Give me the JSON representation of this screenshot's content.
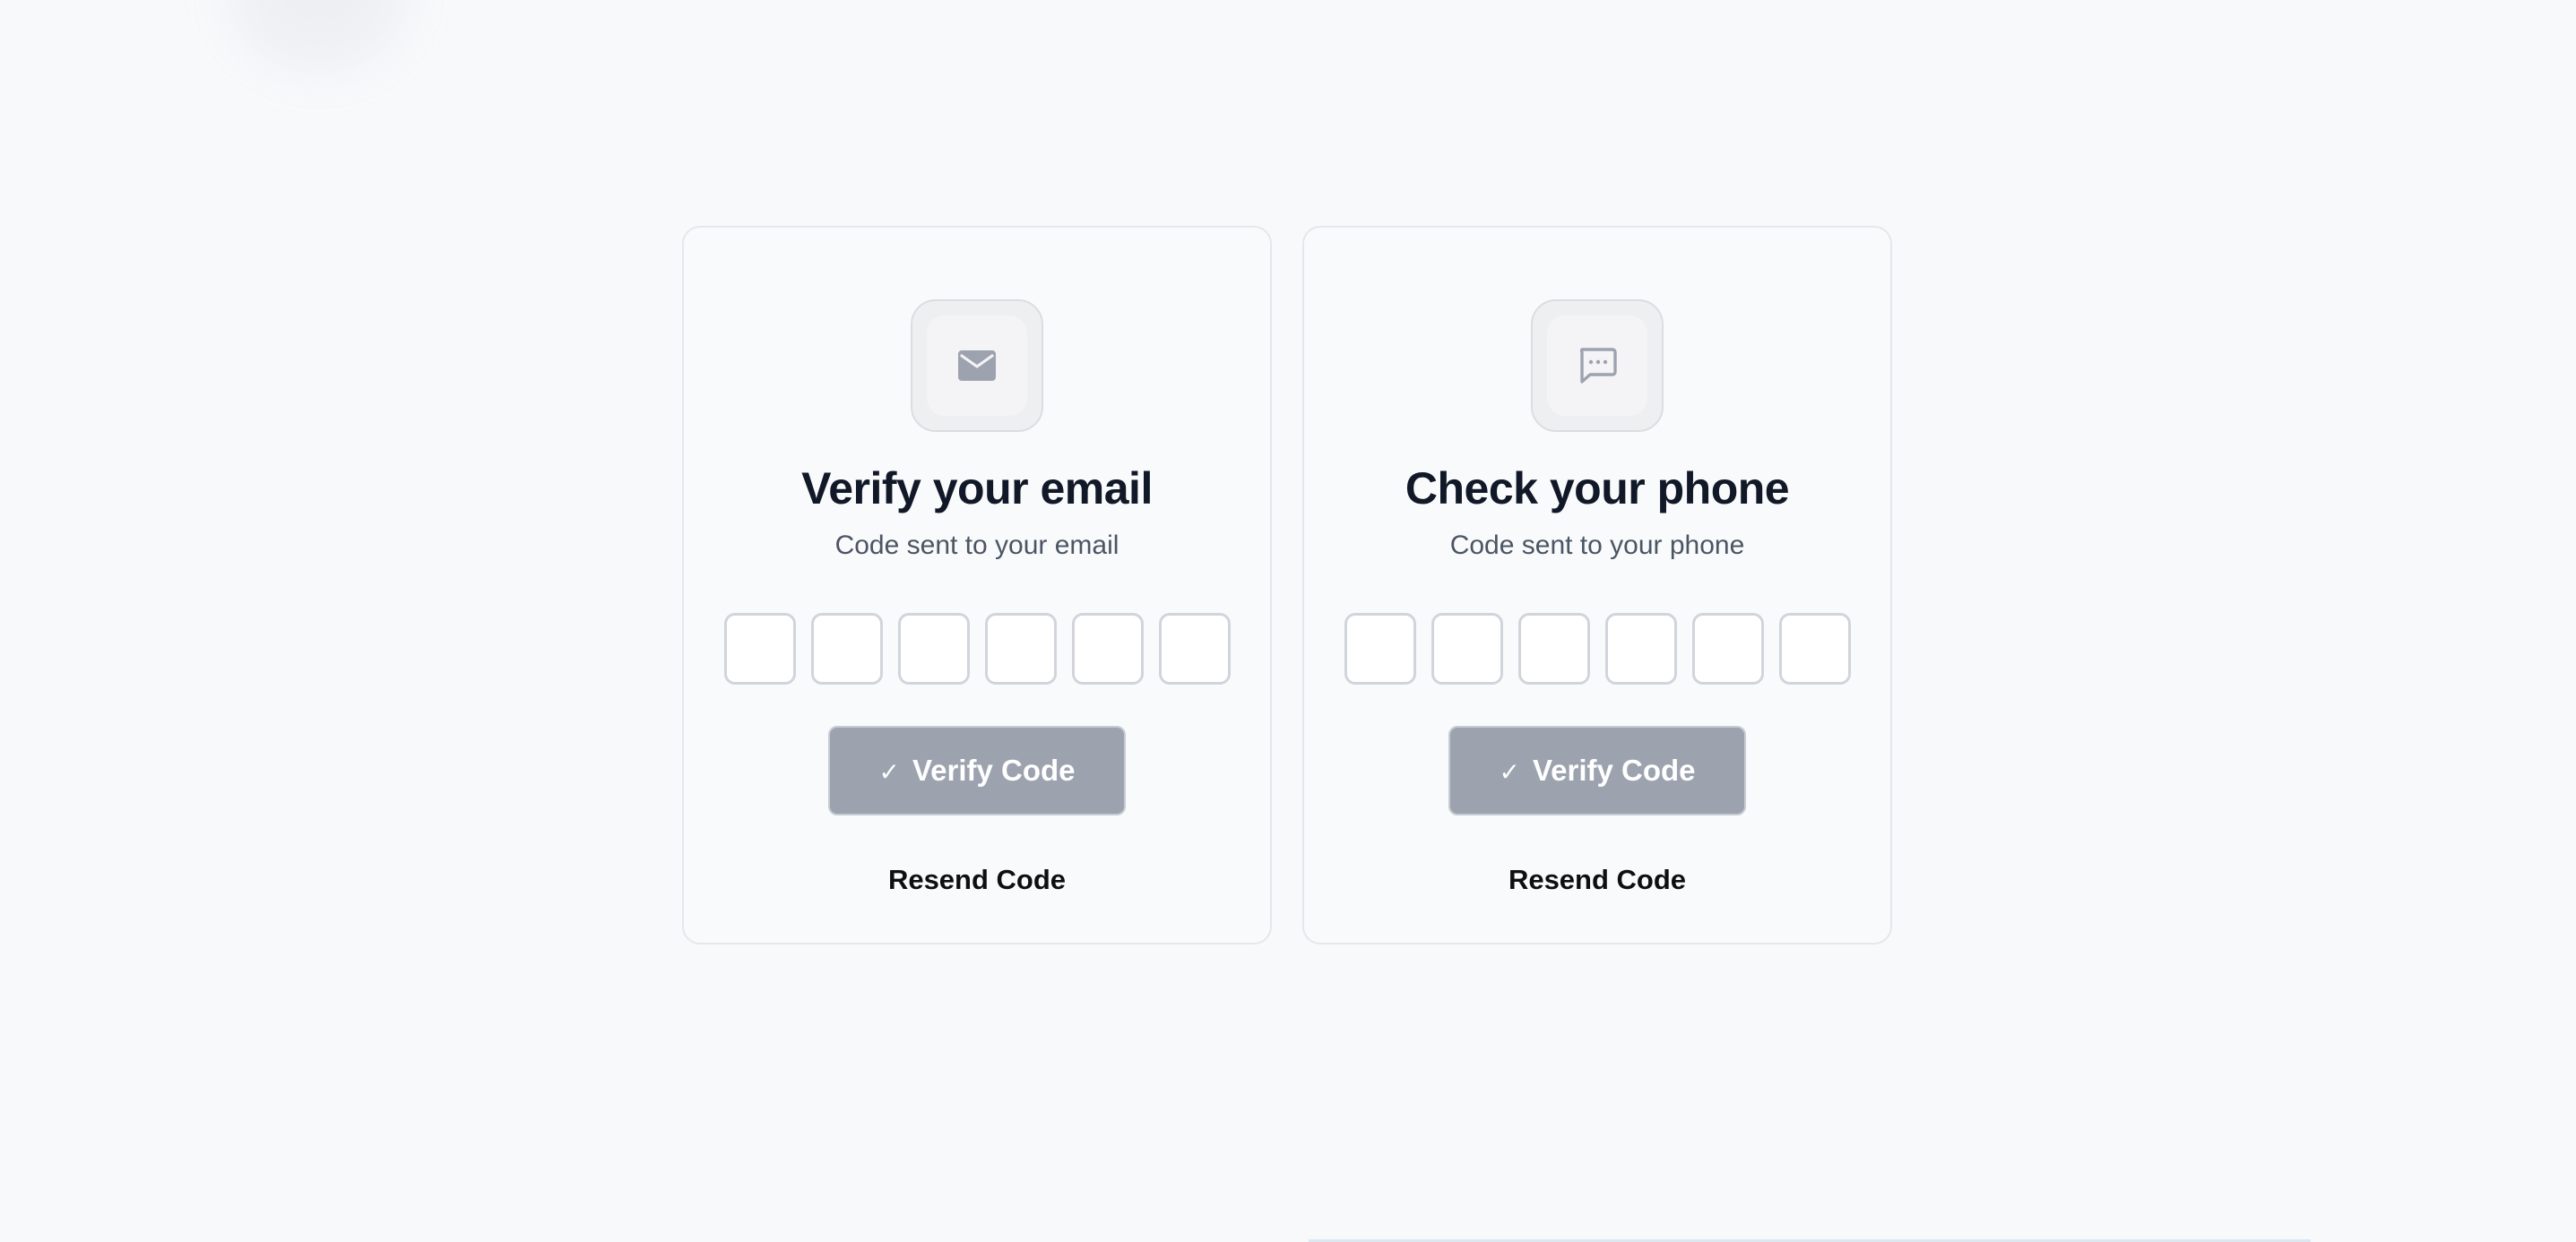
{
  "cards": {
    "email": {
      "icon": "mail-icon",
      "title": "Verify your email",
      "subtitle": "Code sent to your email",
      "code_digits": [
        "",
        "",
        "",
        "",
        "",
        ""
      ],
      "verify_label": "Verify Code",
      "resend_label": "Resend Code"
    },
    "phone": {
      "icon": "message-icon",
      "title": "Check your phone",
      "subtitle": "Code sent to your phone",
      "code_digits": [
        "",
        "",
        "",
        "",
        "",
        ""
      ],
      "verify_label": "Verify Code",
      "resend_label": "Resend Code"
    }
  },
  "colors": {
    "background": "#f8f9fb",
    "card_border": "#e5e7eb",
    "title": "#111827",
    "subtitle": "#4b5563",
    "button_disabled": "#9ca3af",
    "icon": "#9ca3af"
  }
}
